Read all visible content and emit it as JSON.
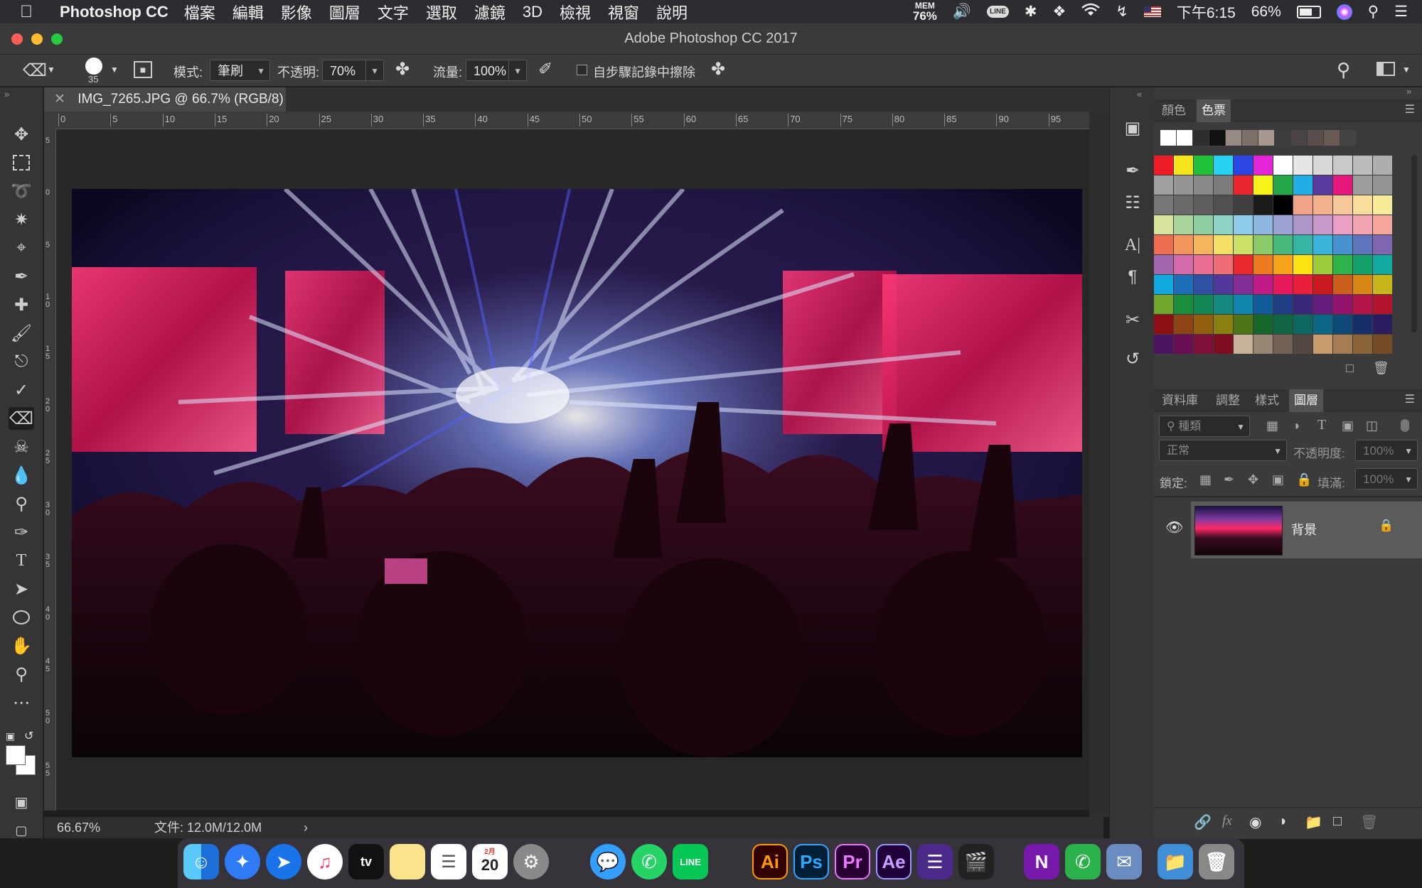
{
  "menubar": {
    "app_name": "Photoshop CC",
    "items": [
      "檔案",
      "編輯",
      "影像",
      "圖層",
      "文字",
      "選取",
      "濾鏡",
      "3D",
      "檢視",
      "視窗",
      "說明"
    ],
    "mem_label": "MEM",
    "mem_value": "76%",
    "time": "下午6:15",
    "battery": "66%"
  },
  "window": {
    "title": "Adobe Photoshop CC 2017"
  },
  "options": {
    "brush_size": "35",
    "mode_label": "模式:",
    "mode_value": "筆刷",
    "opacity_label": "不透明:",
    "opacity_value": "70%",
    "flow_label": "流量:",
    "flow_value": "100%",
    "erase_history_label": "自步驟記錄中擦除"
  },
  "document": {
    "tab_title": "IMG_7265.JPG @ 66.7% (RGB/8)",
    "zoom": "66.67%",
    "file_info": "文件: 12.0M/12.0M",
    "ruler_top": [
      "0",
      "5",
      "10",
      "15",
      "20",
      "25",
      "30",
      "35",
      "40",
      "45",
      "50",
      "55",
      "60",
      "65",
      "70",
      "75",
      "80",
      "85",
      "90",
      "95"
    ],
    "ruler_left": [
      "5",
      "0",
      "5",
      "1 0",
      "1 5",
      "2 0",
      "2 5",
      "3 0",
      "3 5",
      "4 0",
      "4 5",
      "5 0",
      "5 5"
    ]
  },
  "swatches_panel": {
    "tabs": [
      "顏色",
      "色票"
    ],
    "active_tab": "色票",
    "recent": [
      "#ffffff",
      "#ffffff",
      "#2e2e2e",
      "#111111",
      "#9a8a86",
      "#7e7068",
      "#a89890",
      "#3c3c3c",
      "#4a4444",
      "#5a4e4c",
      "#6a5a56",
      "#444444"
    ],
    "rows": [
      [
        "#ee1c25",
        "#f5e51a",
        "#21c13a",
        "#27d1f2",
        "#2c45e4",
        "#e424d8",
        "#ffffff",
        "#e6e6e6",
        "#d8d8d8",
        "#c9c9c9",
        "#bbbbbb",
        "#aeaeae"
      ],
      [
        "#a0a0a0",
        "#959595",
        "#888888",
        "#7b7b7b",
        "#e8252e",
        "#f8f21a",
        "#23a64a",
        "#22aee5",
        "#5b3aa0",
        "#e5177a",
        "#9e9e9e",
        "#959595"
      ],
      [
        "#777777",
        "#6a6a6a",
        "#5e5e5e",
        "#505050",
        "#3f3f3f",
        "#1b1b1b",
        "#000000",
        "#f2a48a",
        "#f3b18e",
        "#f8c79a",
        "#f9dd9a",
        "#f6ec9b"
      ],
      [
        "#d6e49c",
        "#a9d49a",
        "#8fcda3",
        "#8fd3c7",
        "#8ecde9",
        "#90b6e3",
        "#9ca1d6",
        "#ad96c8",
        "#c699c8",
        "#ec9fc5",
        "#f1a3b0",
        "#f4a69b"
      ],
      [
        "#ee6c52",
        "#f2945b",
        "#f7b45f",
        "#f5df67",
        "#cde067",
        "#8cc96b",
        "#47b77b",
        "#36b5a4",
        "#39b4dd",
        "#4892d0",
        "#5f74bd",
        "#7f66b0"
      ],
      [
        "#a267ae",
        "#d46aaa",
        "#ea6e93",
        "#ed6e76",
        "#e7292e",
        "#ee7a20",
        "#f6a21b",
        "#fbe314",
        "#9ccd3a",
        "#30b24a",
        "#14a16b",
        "#12a9a1"
      ],
      [
        "#11a9df",
        "#1c6fb8",
        "#3050a3",
        "#50399a",
        "#832e96",
        "#c01a86",
        "#e81a5c",
        "#e81e3a",
        "#c91a1f",
        "#cc5f1e",
        "#d68716",
        "#c6b61a"
      ],
      [
        "#72a52b",
        "#1c8d3b",
        "#128654",
        "#12887f",
        "#1085b0",
        "#115b98",
        "#1e3f86",
        "#3b277b",
        "#651d7b",
        "#95136d",
        "#b51449",
        "#b3142c"
      ],
      [
        "#8c1014",
        "#8e4416",
        "#93600f",
        "#8c7f12",
        "#4f7519",
        "#16662c",
        "#0f6442",
        "#0e6761",
        "#0c6686",
        "#0f4775",
        "#172f69",
        "#2b1c60"
      ],
      [
        "#4c1560",
        "#6a0f55",
        "#800f39",
        "#7f0e22",
        "#c7b299",
        "#998675",
        "#736357",
        "#534741",
        "#c69c6d",
        "#a67c52",
        "#8c6239",
        "#754c24"
      ]
    ]
  },
  "layers_panel": {
    "tabs": [
      "資料庫",
      "調整",
      "樣式",
      "圖層"
    ],
    "active_tab": "圖層",
    "kind_filter": "種類",
    "blend_mode": "正常",
    "opacity_label": "不透明度:",
    "opacity_value": "100%",
    "lock_label": "鎖定:",
    "fill_label": "填滿:",
    "fill_value": "100%",
    "layers": [
      {
        "name": "背景"
      }
    ]
  },
  "dock": {
    "calendar_month": "2月",
    "calendar_day": "20",
    "app_labels": [
      "Ai",
      "Ps",
      "Pr",
      "Ae",
      "N"
    ]
  }
}
